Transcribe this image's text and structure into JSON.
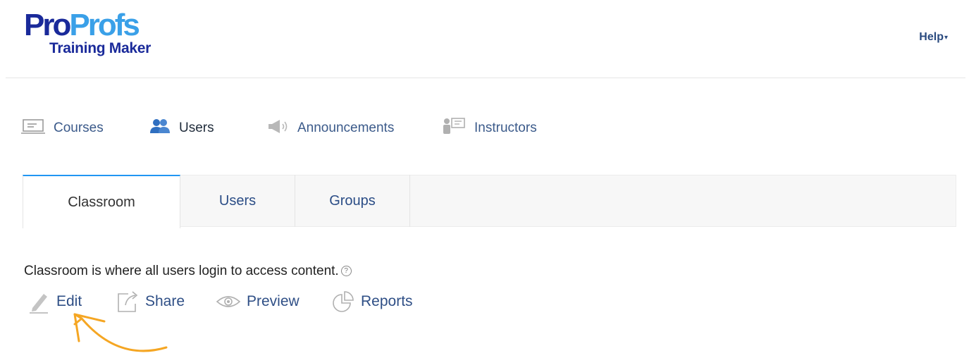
{
  "header": {
    "logo_text_pro": "Pro",
    "logo_text_profs": "Profs",
    "logo_subtitle": "Training Maker",
    "help_label": "Help"
  },
  "nav": {
    "items": [
      {
        "label": "Courses",
        "icon": "monitor-icon"
      },
      {
        "label": "Users",
        "icon": "users-icon",
        "active": true
      },
      {
        "label": "Announcements",
        "icon": "megaphone-icon"
      },
      {
        "label": "Instructors",
        "icon": "instructor-icon"
      }
    ]
  },
  "tabs": [
    {
      "label": "Classroom",
      "active": true
    },
    {
      "label": "Users"
    },
    {
      "label": "Groups"
    }
  ],
  "content": {
    "description": "Classroom is where all users login to access content.",
    "help_glyph": "?",
    "actions": [
      {
        "label": "Edit",
        "icon": "pencil-icon"
      },
      {
        "label": "Share",
        "icon": "share-icon"
      },
      {
        "label": "Preview",
        "icon": "eye-icon"
      },
      {
        "label": "Reports",
        "icon": "pie-chart-icon"
      }
    ]
  },
  "colors": {
    "brand_dark": "#1a2a9a",
    "brand_light": "#3aa0e8",
    "link": "#2f4f86",
    "tab_accent": "#2196f3",
    "annotation_arrow": "#f5a623"
  }
}
